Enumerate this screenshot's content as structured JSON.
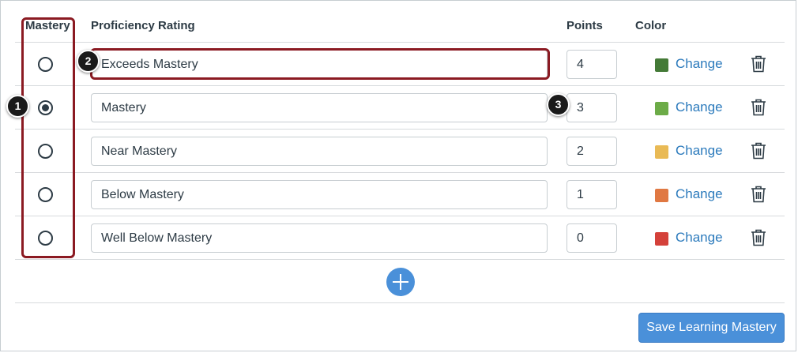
{
  "headers": {
    "mastery": "Mastery",
    "rating": "Proficiency Rating",
    "points": "Points",
    "color": "Color"
  },
  "ratings": [
    {
      "name": "Exceeds Mastery",
      "points": "4",
      "color": "#447a37",
      "change_label": "Change",
      "is_mastery": false
    },
    {
      "name": "Mastery",
      "points": "3",
      "color": "#6cab47",
      "change_label": "Change",
      "is_mastery": true
    },
    {
      "name": "Near Mastery",
      "points": "2",
      "color": "#e9ba55",
      "change_label": "Change",
      "is_mastery": false
    },
    {
      "name": "Below Mastery",
      "points": "1",
      "color": "#e07842",
      "change_label": "Change",
      "is_mastery": false
    },
    {
      "name": "Well Below Mastery",
      "points": "0",
      "color": "#d4413a",
      "change_label": "Change",
      "is_mastery": false
    }
  ],
  "callouts": [
    "1",
    "2",
    "3"
  ],
  "actions": {
    "add_icon": "plus-icon",
    "save_label": "Save Learning Mastery"
  },
  "icons": {
    "delete": "trash-icon"
  },
  "colors": {
    "link": "#2b7abc",
    "button": "#4a90d9",
    "highlight": "#8b1a22"
  }
}
